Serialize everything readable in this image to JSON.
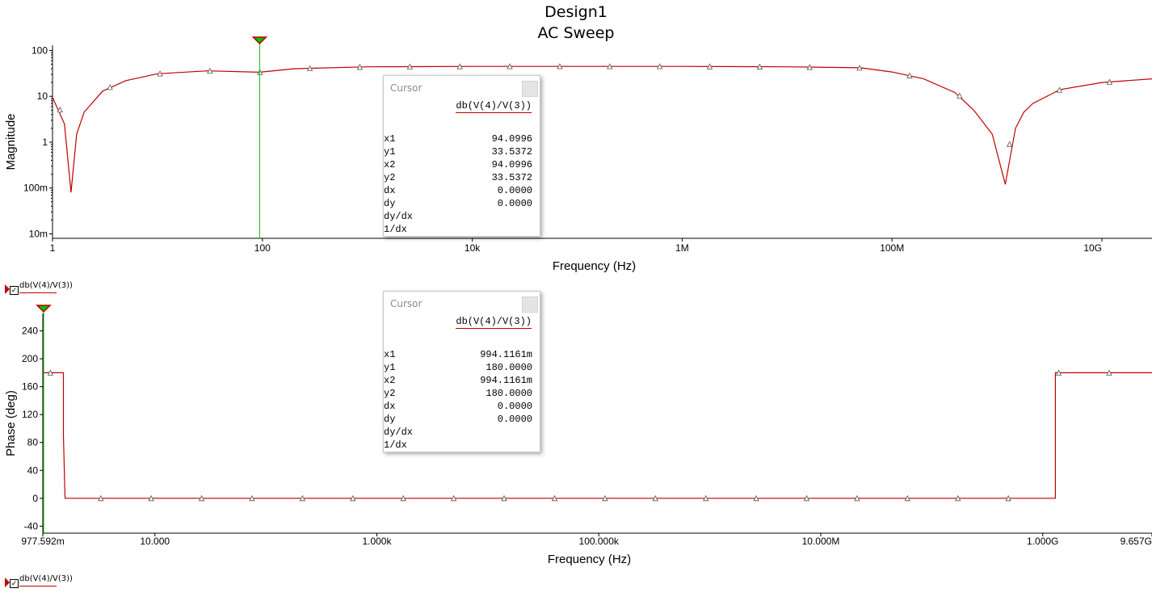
{
  "window": {
    "title": "Design1",
    "subtitle": "AC Sweep"
  },
  "colors": {
    "trace": "#c00000",
    "cursor": "#00c000",
    "background": "#ffffff"
  },
  "legend": {
    "top_label": "db(V(4)/V(3))",
    "bottom_label": "db(V(4)/V(3))"
  },
  "cursor_panels": [
    {
      "header": "Cursor",
      "trace_label": "db(V(4)/V(3))",
      "rows": [
        {
          "key": "x1",
          "value": "94.0996"
        },
        {
          "key": "y1",
          "value": "33.5372"
        },
        {
          "key": "x2",
          "value": "94.0996"
        },
        {
          "key": "y2",
          "value": "33.5372"
        },
        {
          "key": "dx",
          "value": "0.0000"
        },
        {
          "key": "dy",
          "value": "0.0000"
        },
        {
          "key": "dy/dx",
          "value": ""
        },
        {
          "key": "1/dx",
          "value": ""
        }
      ]
    },
    {
      "header": "Cursor",
      "trace_label": "db(V(4)/V(3))",
      "rows": [
        {
          "key": "x1",
          "value": "994.1161m"
        },
        {
          "key": "y1",
          "value": "180.0000"
        },
        {
          "key": "x2",
          "value": "994.1161m"
        },
        {
          "key": "y2",
          "value": "180.0000"
        },
        {
          "key": "dx",
          "value": "0.0000"
        },
        {
          "key": "dy",
          "value": "0.0000"
        },
        {
          "key": "dy/dx",
          "value": ""
        },
        {
          "key": "1/dx",
          "value": ""
        }
      ]
    }
  ],
  "chart_data": [
    {
      "type": "line",
      "xlabel": "Frequency (Hz)",
      "ylabel": "Magnitude",
      "x_scale": "log",
      "y_scale": "log",
      "xlim": [
        1,
        30000000000
      ],
      "ylim": [
        0.008,
        130
      ],
      "x_ticks": [
        {
          "value": 1,
          "label": "1"
        },
        {
          "value": 100,
          "label": "100"
        },
        {
          "value": 10000,
          "label": "10k"
        },
        {
          "value": 1000000,
          "label": "1M"
        },
        {
          "value": 100000000,
          "label": "100M"
        },
        {
          "value": 10000000000,
          "label": "10G"
        }
      ],
      "y_ticks": [
        {
          "value": 100,
          "label": "100"
        },
        {
          "value": 10,
          "label": "10"
        },
        {
          "value": 1,
          "label": "1"
        },
        {
          "value": 0.1,
          "label": "100m"
        },
        {
          "value": 0.01,
          "label": "10m"
        }
      ],
      "cursor_x": 94.0996,
      "series": [
        {
          "color": "#c00000",
          "x": [
            1,
            1.3,
            1.5,
            1.7,
            2,
            3,
            5,
            10,
            30,
            94.1,
            200,
            1000,
            10000,
            100000,
            1000000,
            10000000,
            50000000,
            100000000,
            200000000,
            400000000,
            600000000,
            900000000,
            1200000000,
            1500000000,
            1800000000,
            2200000000,
            4000000000,
            10000000000,
            30000000000
          ],
          "y": [
            9.5,
            2.5,
            0.08,
            1.5,
            4.5,
            13,
            22,
            31,
            36,
            33.5,
            40,
            44,
            45,
            45,
            45,
            44,
            42,
            34,
            24,
            12,
            5,
            1.5,
            0.12,
            2,
            4.5,
            7,
            14,
            20,
            24
          ]
        }
      ]
    },
    {
      "type": "line",
      "xlabel": "Frequency (Hz)",
      "ylabel": "Phase (deg)",
      "x_scale": "log",
      "y_scale": "linear",
      "xlim": [
        0.977592,
        9657000000
      ],
      "ylim": [
        -50,
        265
      ],
      "x_ticks": [
        {
          "value": 0.977592,
          "label": "977.592m"
        },
        {
          "value": 10,
          "label": "10.000"
        },
        {
          "value": 1000,
          "label": "1.000k"
        },
        {
          "value": 100000,
          "label": "100.000k"
        },
        {
          "value": 10000000,
          "label": "10.000M"
        },
        {
          "value": 1000000000,
          "label": "1.000G"
        },
        {
          "value": 9657000000,
          "label": "9.657G"
        }
      ],
      "y_ticks": [
        {
          "value": 240,
          "label": "240"
        },
        {
          "value": 200,
          "label": "200"
        },
        {
          "value": 160,
          "label": "160"
        },
        {
          "value": 120,
          "label": "120"
        },
        {
          "value": 80,
          "label": "80"
        },
        {
          "value": 40,
          "label": "40"
        },
        {
          "value": 0,
          "label": "0"
        },
        {
          "value": -40,
          "label": "-40"
        }
      ],
      "cursor_x": 0.9941161,
      "series": [
        {
          "color": "#c00000",
          "x": [
            0.977592,
            1.5,
            1.5,
            1.55,
            1300000000,
            1300000000,
            9657000000
          ],
          "y": [
            180,
            180,
            90,
            0,
            0,
            180,
            180
          ]
        }
      ]
    }
  ]
}
